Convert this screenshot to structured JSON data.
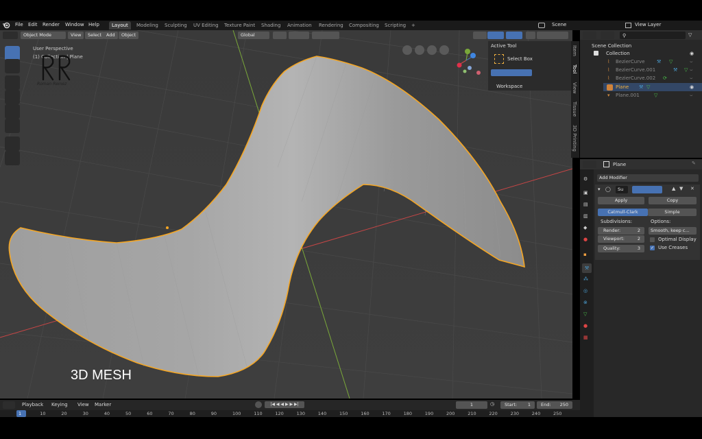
{
  "topbar": {
    "menus": [
      "File",
      "Edit",
      "Render",
      "Window",
      "Help"
    ],
    "workspaces": [
      "Layout",
      "Modeling",
      "Sculpting",
      "UV Editing",
      "Texture Paint",
      "Shading",
      "Animation",
      "Rendering",
      "Compositing",
      "Scripting"
    ],
    "active_workspace": "Layout",
    "add_tab": "+",
    "scene": "Scene",
    "view_layer": "View Layer"
  },
  "viewport_header": {
    "mode": "Object Mode",
    "menus": [
      "View",
      "Select",
      "Add",
      "Object"
    ],
    "orientation": "Global"
  },
  "viewport": {
    "perspective": "User Perspective",
    "collection": "(1) Collection | Plane",
    "overlay_text": "3D MESH",
    "logo_letters": "R R",
    "logo_signature": "Roman Reinez"
  },
  "sidebar": {
    "active_tool_header": "Active Tool",
    "tool_name": "Select Box",
    "workspace_header": "Workspace",
    "tabs": [
      "Item",
      "Tool",
      "View",
      "Tissue",
      "3D Printing"
    ]
  },
  "outliner": {
    "search_placeholder": "",
    "root": "Scene Collection",
    "collection": "Collection",
    "items": [
      "BezierCurve",
      "BezierCurve.001",
      "BezierCurve.002",
      "Plane",
      "Plane.001"
    ]
  },
  "properties": {
    "object_name": "Plane",
    "add_modifier": "Add Modifier",
    "modifier_name": "Su",
    "apply": "Apply",
    "copy": "Copy",
    "catmull": "Catmull-Clark",
    "simple": "Simple",
    "subdivisions_label": "Subdivisions:",
    "options_label": "Options:",
    "render_label": "Render:",
    "render_value": "2",
    "viewport_label": "Viewport:",
    "viewport_value": "2",
    "quality_label": "Quality:",
    "quality_value": "3",
    "uv_smooth": "Smooth, keep c...",
    "optimal_display": "Optimal Display",
    "use_creases": "Use Creases",
    "optimal_checked": false,
    "creases_checked": true
  },
  "timeline": {
    "menus": [
      "Playback",
      "Keying",
      "View",
      "Marker"
    ],
    "current_frame": "1",
    "start_label": "Start:",
    "start_value": "1",
    "end_label": "End:",
    "end_value": "250",
    "ruler": [
      "1",
      "10",
      "20",
      "30",
      "40",
      "50",
      "60",
      "70",
      "80",
      "90",
      "100",
      "110",
      "120",
      "130",
      "140",
      "150",
      "160",
      "170",
      "180",
      "190",
      "200",
      "210",
      "220",
      "230",
      "240",
      "250"
    ]
  },
  "colors": {
    "accent": "#4772b3",
    "selection": "#f5a623",
    "active_item": "#f0b040",
    "x_axis": "#c84646",
    "y_axis": "#7aa83a"
  }
}
